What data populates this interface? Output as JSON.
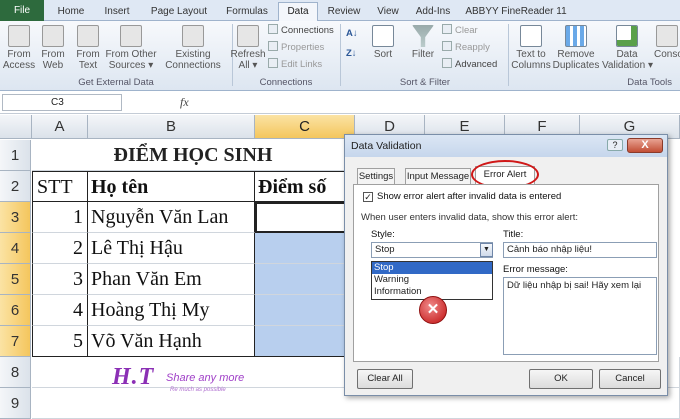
{
  "tabs": [
    "File",
    "Home",
    "Insert",
    "Page Layout",
    "Formulas",
    "Data",
    "Review",
    "View",
    "Add-Ins",
    "ABBYY FineReader 11"
  ],
  "ribbon": {
    "from_access": "From\nAccess",
    "from_web": "From\nWeb",
    "from_text": "From\nText",
    "from_other": "From Other\nSources ▾",
    "existing": "Existing\nConnections",
    "refresh": "Refresh\nAll ▾",
    "connections": "Connections",
    "properties": "Properties",
    "edit_links": "Edit Links",
    "sort": "Sort",
    "filter": "Filter",
    "clear": "Clear",
    "reapply": "Reapply",
    "advanced": "Advanced",
    "text_to_columns": "Text to\nColumns",
    "remove_duplicates": "Remove\nDuplicates",
    "data_validation": "Data\nValidation ▾",
    "consolidate": "Conso",
    "group_external": "Get External Data",
    "group_connections": "Connections",
    "group_sort": "Sort & Filter",
    "group_tools": "Data Tools"
  },
  "name_box": "C3",
  "fx": "fx",
  "columns": [
    "A",
    "B",
    "C",
    "D",
    "E",
    "F",
    "G"
  ],
  "rows": [
    "1",
    "2",
    "3",
    "4",
    "5",
    "6",
    "7",
    "8",
    "9"
  ],
  "sheet": {
    "title": "ĐIỂM HỌC SINH",
    "headers": {
      "stt": "STT",
      "name": "Họ tên",
      "score": "Điểm số"
    },
    "students": [
      {
        "stt": "1",
        "name": "Nguyễn Văn Lan"
      },
      {
        "stt": "2",
        "name": "Lê Thị Hậu"
      },
      {
        "stt": "3",
        "name": "Phan Văn Em"
      },
      {
        "stt": "4",
        "name": "Hoàng Thị My"
      },
      {
        "stt": "5",
        "name": "Võ Văn Hạnh"
      }
    ]
  },
  "dialog": {
    "title": "Data Validation",
    "help": "?",
    "close": "X",
    "tabs": [
      "Settings",
      "Input Message",
      "Error Alert"
    ],
    "show_alert": "Show error alert after invalid data is entered",
    "when_invalid": "When user enters invalid data, show this error alert:",
    "style_label": "Style:",
    "style_value": "Stop",
    "style_options": [
      "Stop",
      "Warning",
      "Information"
    ],
    "title_label": "Title:",
    "title_value": "Cảnh báo nhập liệu!",
    "error_label": "Error message:",
    "error_value": "Dữ liệu nhập bị sai! Hãy xem lại",
    "clear_all": "Clear All",
    "ok": "OK",
    "cancel": "Cancel"
  },
  "watermark": {
    "logo": "H.T",
    "slogan": "Share any more",
    "sub": "Re much as possible"
  }
}
